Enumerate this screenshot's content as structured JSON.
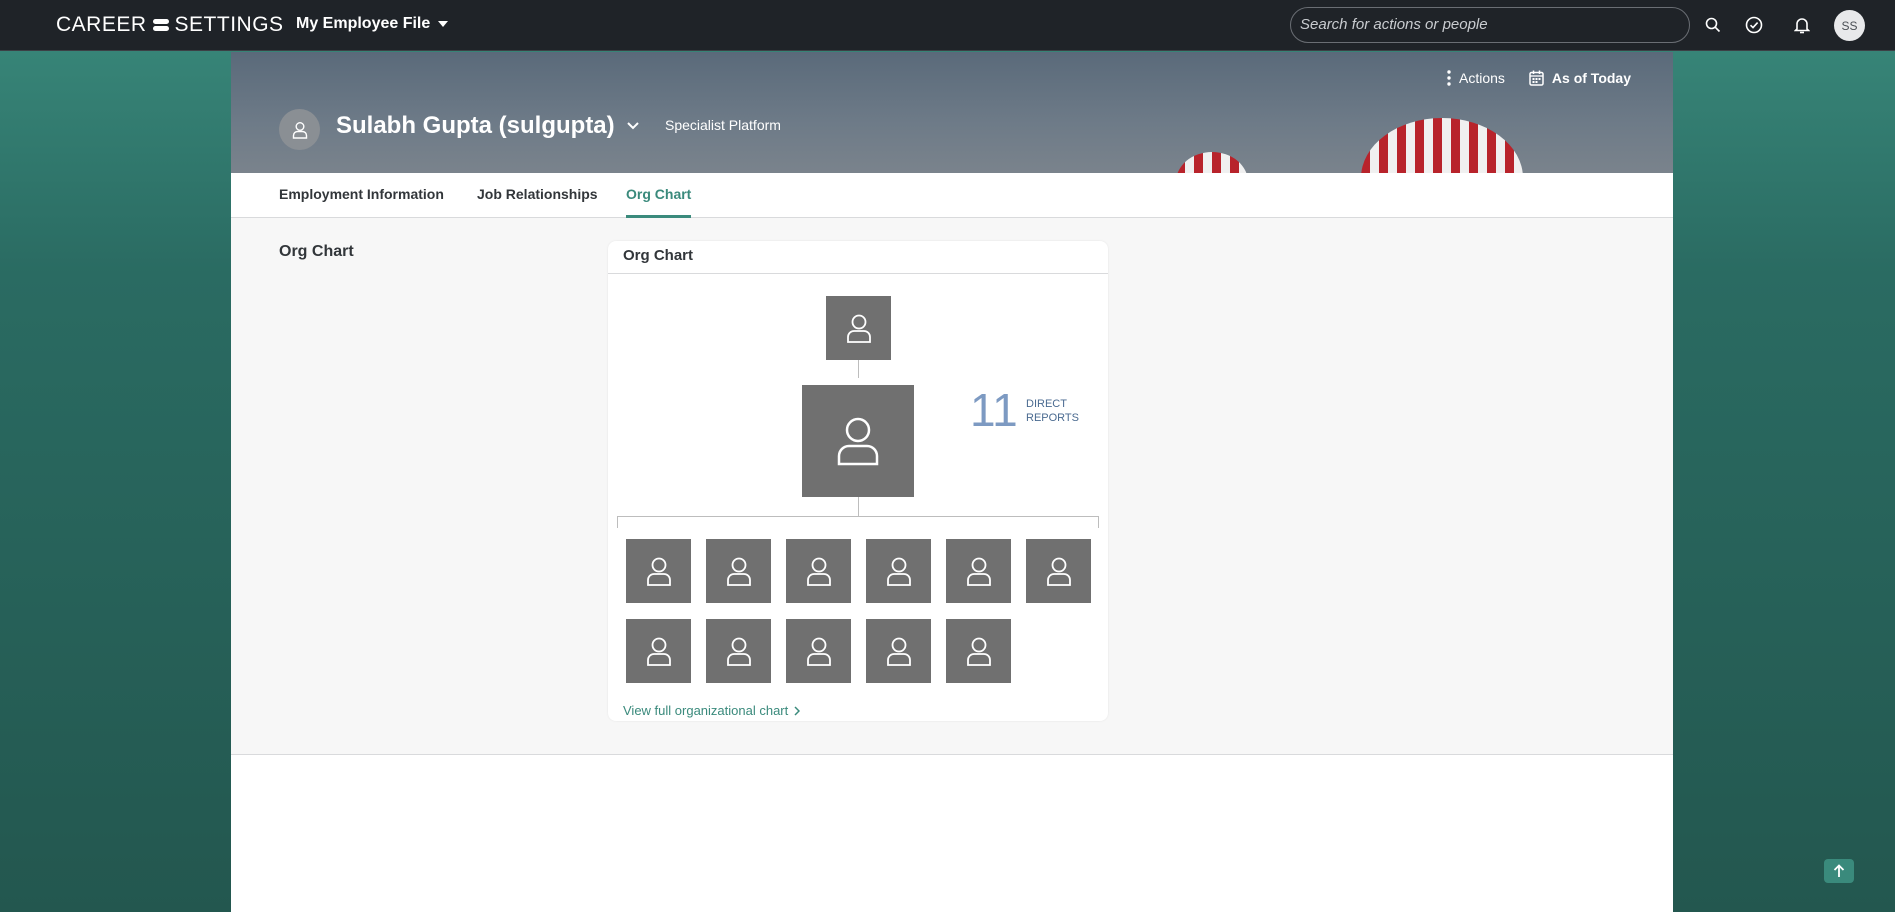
{
  "shell": {
    "logo_left": "CAREER",
    "logo_right": "SETTINGS",
    "app_menu_label": "My Employee File",
    "search_placeholder": "Search for actions or people",
    "user_initials": "SS"
  },
  "header": {
    "actions_label": "Actions",
    "date_label": "As of Today",
    "name": "Sulabh Gupta (sulgupta)",
    "subtitle": "Specialist Platform"
  },
  "tabs": [
    {
      "label": "Employment Information",
      "active": false
    },
    {
      "label": "Job Relationships",
      "active": false
    },
    {
      "label": "Org Chart",
      "active": true
    }
  ],
  "section": {
    "title": "Org Chart"
  },
  "org_card": {
    "title": "Org Chart",
    "direct_reports_count": "11",
    "direct_reports_label_1": "DIRECT",
    "direct_reports_label_2": "REPORTS",
    "view_full_link": "View full organizational chart"
  },
  "colors": {
    "accent": "#3a8a7c",
    "shell": "#1f2328",
    "node": "#707070",
    "count": "#7d9ac2"
  },
  "icons": {
    "search": "search-icon",
    "tasks": "check-circle-icon",
    "notifications": "bell-icon",
    "actions": "vertical-dots-icon",
    "calendar": "calendar-icon",
    "person": "person-icon",
    "scroll_top": "arrow-up-icon"
  }
}
